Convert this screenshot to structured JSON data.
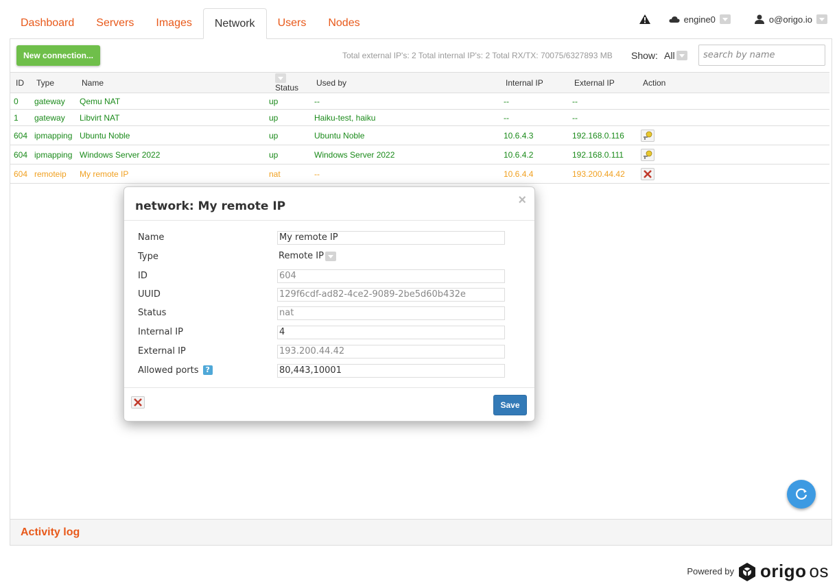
{
  "nav": {
    "tabs": [
      "Dashboard",
      "Servers",
      "Images",
      "Network",
      "Users",
      "Nodes"
    ],
    "active": "Network"
  },
  "header": {
    "engine": "engine0",
    "user": "o@origo.io"
  },
  "toolbar": {
    "new_connection": "New connection...",
    "totals": "Total external IP's: 2  Total internal IP's: 2  Total RX/TX: 70075/6327893 MB",
    "show_label": "Show:",
    "show_value": "All",
    "search_placeholder": "search by name"
  },
  "table": {
    "headers": {
      "id": "ID",
      "type": "Type",
      "name": "Name",
      "status": "Status",
      "used_by": "Used by",
      "internal_ip": "Internal IP",
      "external_ip": "External IP",
      "action": "Action"
    },
    "rows": [
      {
        "id": "0",
        "type": "gateway",
        "name": "Qemu NAT",
        "status": "up",
        "used_by": "--",
        "internal_ip": "--",
        "external_ip": "--"
      },
      {
        "id": "1",
        "type": "gateway",
        "name": "Libvirt NAT",
        "status": "up",
        "used_by": "Haiku-test, haiku",
        "internal_ip": "--",
        "external_ip": "--"
      },
      {
        "id": "604",
        "type": "ipmapping",
        "name": "Ubuntu Noble",
        "status": "up",
        "used_by": "Ubuntu Noble",
        "internal_ip": "10.6.4.3",
        "external_ip": "192.168.0.116"
      },
      {
        "id": "604",
        "type": "ipmapping",
        "name": "Windows Server 2022",
        "status": "up",
        "used_by": "Windows Server 2022",
        "internal_ip": "10.6.4.2",
        "external_ip": "192.168.0.111"
      },
      {
        "id": "604",
        "type": "remoteip",
        "name": "My remote IP",
        "status": "nat",
        "used_by": "--",
        "internal_ip": "10.6.4.4",
        "external_ip": "193.200.44.42"
      }
    ]
  },
  "modal": {
    "title": "network: My remote IP",
    "close": "×",
    "fields": {
      "name_label": "Name",
      "name_value": "My remote IP",
      "type_label": "Type",
      "type_value": "Remote IP",
      "id_label": "ID",
      "id_value": "604",
      "uuid_label": "UUID",
      "uuid_value": "129f6cdf-ad82-4ce2-9089-2be5d60b432e",
      "status_label": "Status",
      "status_value": "nat",
      "internal_label": "Internal IP",
      "internal_value": "4",
      "external_label": "External IP",
      "external_value": "193.200.44.42",
      "ports_label": "Allowed ports",
      "ports_value": "80,443,10001"
    },
    "help": "?",
    "save": "Save"
  },
  "activity": "Activity log",
  "footer": {
    "powered_by": "Powered by",
    "brand": "origo",
    "brand_os": "os"
  },
  "colors": {
    "accent": "#e8591a",
    "up_green": "#1a8a1a",
    "warn_orange": "#f0a020",
    "primary_blue": "#337ab7",
    "new_green": "#6fbf4a"
  }
}
